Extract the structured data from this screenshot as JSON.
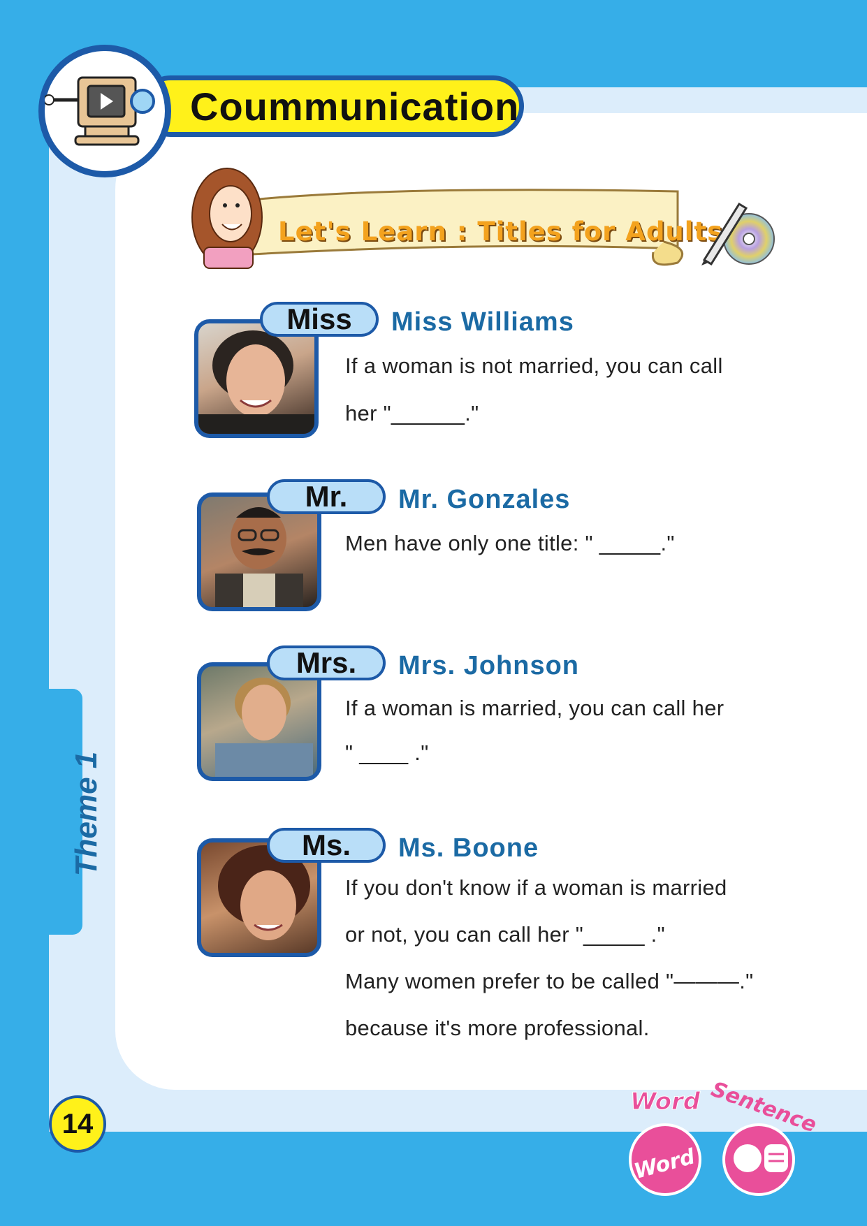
{
  "header": {
    "title": "Coummunication"
  },
  "banner": {
    "text": "Let's Learn : Titles for Adults"
  },
  "entries": [
    {
      "tab": "Miss",
      "name": "Miss Williams",
      "lines": [
        "If a woman is not married, you can call",
        "her \"______.\""
      ]
    },
    {
      "tab": "Mr.",
      "name": "Mr. Gonzales",
      "lines": [
        "Men have only one title: \" _____.\""
      ]
    },
    {
      "tab": "Mrs.",
      "name": "Mrs. Johnson",
      "lines": [
        "If a woman is married, you can call her",
        "\" ____  .\""
      ]
    },
    {
      "tab": "Ms.",
      "name": "Ms. Boone",
      "lines": [
        "If you don't know if a woman is married",
        "or not, you can call her \"_____ .\"",
        "Many women prefer to be called \"———.\"",
        "because it's more professional."
      ]
    }
  ],
  "side_tab": {
    "label": "Theme 1"
  },
  "footer": {
    "page_number": "14",
    "sticker_word": "Word",
    "sticker_sentence": "Sentence"
  }
}
